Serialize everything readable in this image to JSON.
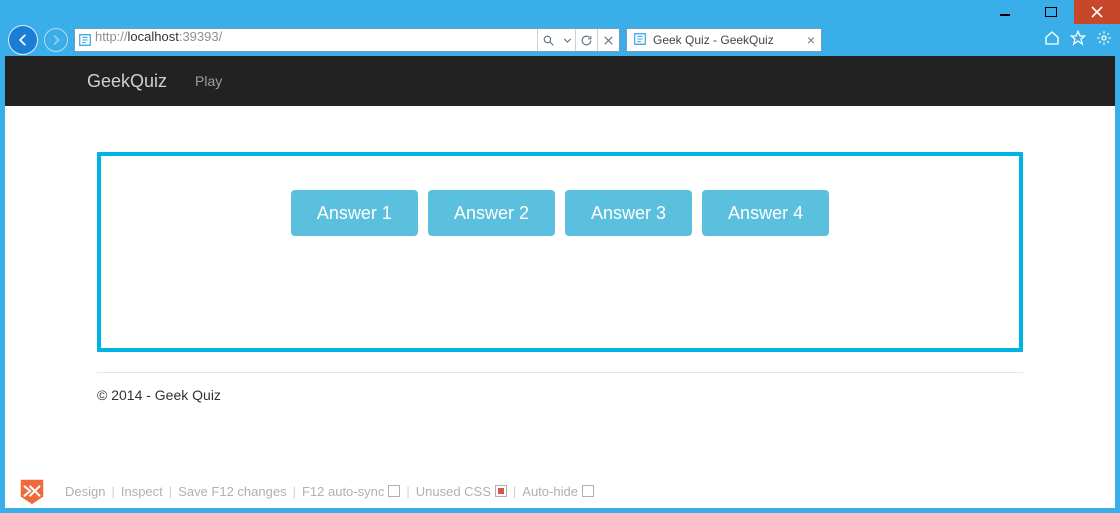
{
  "window": {
    "url_prefix": "http://",
    "url_host": "localhost",
    "url_port": ":39393/",
    "tab_title": "Geek Quiz - GeekQuiz"
  },
  "nav": {
    "brand": "GeekQuiz",
    "play": "Play"
  },
  "quiz": {
    "answers": [
      "Answer 1",
      "Answer 2",
      "Answer 3",
      "Answer 4"
    ]
  },
  "footer": "© 2014 - Geek Quiz",
  "devbar": {
    "design": "Design",
    "inspect": "Inspect",
    "save": "Save F12 changes",
    "autosync": "F12 auto-sync",
    "unused": "Unused CSS",
    "autohide": "Auto-hide"
  }
}
